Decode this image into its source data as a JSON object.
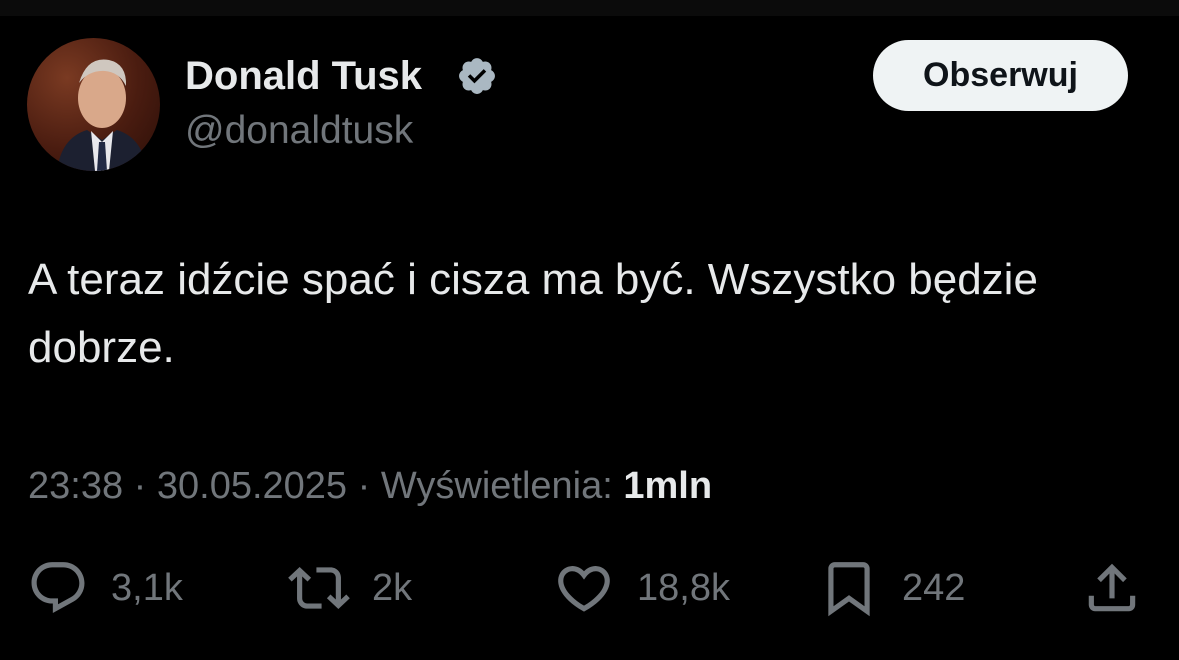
{
  "author": {
    "name": "Donald Tusk",
    "handle": "@donaldtusk",
    "verified": true,
    "verified_color": "#aab8c2"
  },
  "follow_button": {
    "label": "Obserwuj"
  },
  "tweet": {
    "text": "A teraz idźcie spać i cisza ma być. Wszystko będzie dobrze.",
    "time": "23:38",
    "date": "30.05.2025",
    "separator": "·",
    "views_label": "Wyświetlenia:",
    "views_count": "1mln"
  },
  "actions": {
    "replies": {
      "icon": "reply-icon",
      "count": "3,1k"
    },
    "reposts": {
      "icon": "repost-icon",
      "count": "2k"
    },
    "likes": {
      "icon": "heart-icon",
      "count": "18,8k"
    },
    "bookmarks": {
      "icon": "bookmark-icon",
      "count": "242"
    },
    "share": {
      "icon": "share-icon"
    }
  },
  "colors": {
    "background": "#000000",
    "primary_text": "#e7e9ea",
    "secondary_text": "#71767b",
    "button_bg": "#eff3f4"
  }
}
